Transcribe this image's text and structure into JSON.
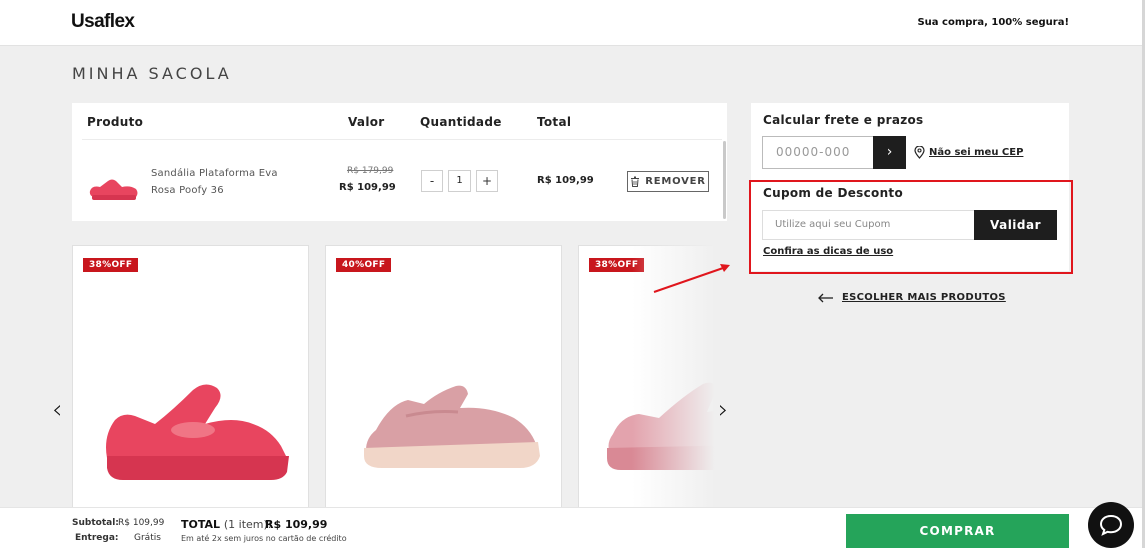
{
  "header": {
    "logo": "Usaflex",
    "secure_text": "Sua compra, 100% segura!"
  },
  "page_title": "MINHA SACOLA",
  "cart": {
    "headers": {
      "product": "Produto",
      "price": "Valor",
      "quantity": "Quantidade",
      "total": "Total"
    },
    "item": {
      "name": "Sandália Plataforma Eva Rosa Poofy 36",
      "old_price": "R$ 179,99",
      "price": "R$ 109,99",
      "minus": "-",
      "quantity": "1",
      "plus": "+",
      "total": "R$ 109,99",
      "remove_label": "REMOVER"
    }
  },
  "recommendations": [
    {
      "badge": "38%OFF",
      "color": "#e8455f"
    },
    {
      "badge": "40%OFF",
      "color": "#d9a0a5"
    },
    {
      "badge": "38%OFF",
      "color": "#e3a3ad"
    }
  ],
  "carousel": {
    "prev": "‹",
    "next": "›"
  },
  "freight": {
    "title": "Calcular frete e prazos",
    "cep_placeholder": "00000-000",
    "cep_button": "›",
    "cep_link": "Não sei meu CEP"
  },
  "coupon": {
    "title": "Cupom de Desconto",
    "placeholder": "Utilize aqui seu Cupom",
    "button": "Validar",
    "tips_link": "Confira as dicas de uso"
  },
  "more_products": "ESCOLHER MAIS PRODUTOS",
  "footer": {
    "subtotal_label": "Subtotal:",
    "subtotal_value": "R$ 109,99",
    "shipping_label": "Entrega:",
    "shipping_value": "Grátis",
    "total_label": "TOTAL",
    "total_items": "(1 item):",
    "total_value": "R$ 109,99",
    "installments": "Em até 2x sem juros no cartão de crédito",
    "buy_button": "COMPRAR"
  },
  "colors": {
    "accent_green": "#25a45a",
    "discount_red": "#c8161d",
    "highlight_red": "#e0161d",
    "dark": "#1e1e1e"
  }
}
